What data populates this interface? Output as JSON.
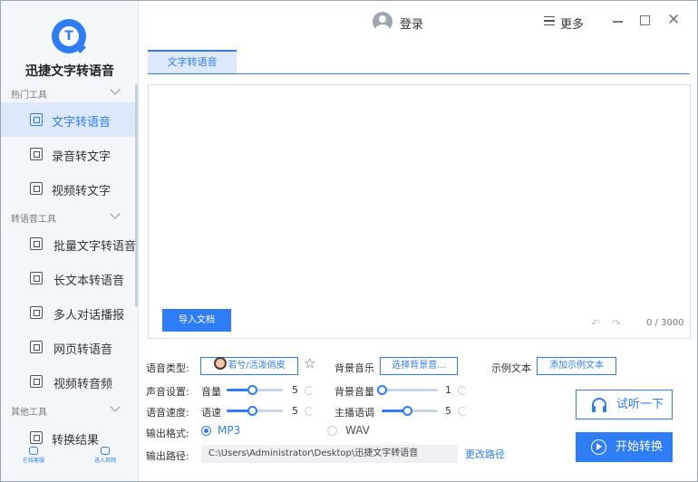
{
  "app": {
    "name": "迅捷文字转语音"
  },
  "header": {
    "login": "登录",
    "more": "更多",
    "close": "✕"
  },
  "sidebar": {
    "sections": [
      {
        "title": "热门工具"
      },
      {
        "title": "转语音工具"
      },
      {
        "title": "其他工具"
      }
    ],
    "items": [
      {
        "label": "文字转语音",
        "active": true
      },
      {
        "label": "录音转文字"
      },
      {
        "label": "视频转文字"
      },
      {
        "label": "批量文字转语音"
      },
      {
        "label": "长文本转语音"
      },
      {
        "label": "多人对话播报"
      },
      {
        "label": "网页转语音"
      },
      {
        "label": "视频转音频"
      },
      {
        "label": "转换结果"
      }
    ],
    "footer": [
      {
        "label": "在线客服"
      },
      {
        "label": "进入官网"
      }
    ]
  },
  "tabs": [
    {
      "label": "文字转语音",
      "active": true
    }
  ],
  "editor": {
    "import_button": "导入文档",
    "undo": "↶",
    "redo": "↷",
    "counter": "0 / 3000"
  },
  "settings": {
    "voice_type_label": "语音类型:",
    "voice_button": "若兮/活泼俏皮",
    "star": "☆",
    "bg_music_label": "背景音乐",
    "bg_music_button": "选择背景音...",
    "sample_text_label": "示例文本",
    "sample_text_button": "添加示例文本",
    "sound_label": "声音设置:",
    "volume_label": "音量",
    "volume_value": "5",
    "volume_fraction": 0.45,
    "bg_volume_label": "背景音量",
    "bg_volume_value": "1",
    "bg_volume_fraction": 0.0,
    "speed_label": "语音速度:",
    "speed_sub_label": "语速",
    "speed_value": "5",
    "speed_fraction": 0.45,
    "pitch_label": "主播语调",
    "pitch_value": "5",
    "pitch_fraction": 0.45,
    "format_label": "输出格式:",
    "formats": [
      {
        "label": "MP3",
        "selected": true
      },
      {
        "label": "WAV",
        "selected": false
      }
    ],
    "path_label": "输出路径:",
    "path_value": "C:\\Users\\Administrator\\Desktop\\迅捷文字转语音",
    "change_path": "更改路径"
  },
  "actions": {
    "listen": "试听一下",
    "start": "开始转换"
  },
  "colors": {
    "accent": "#2f7df4",
    "sidebar_bg": "#f3f7fc",
    "active_bg": "#dde9fb"
  }
}
